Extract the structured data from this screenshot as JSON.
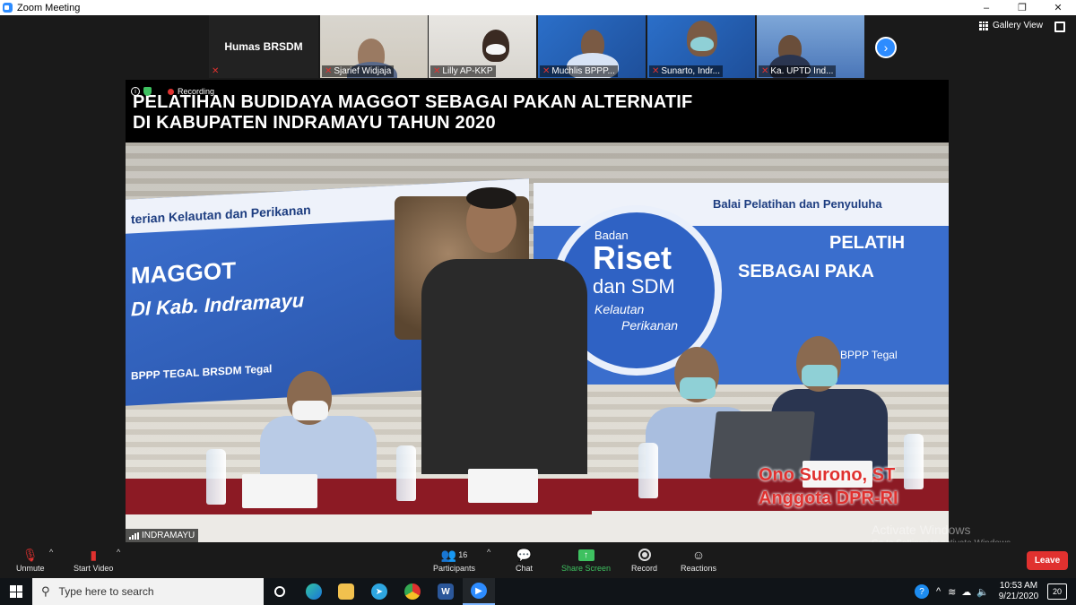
{
  "window": {
    "title": "Zoom Meeting",
    "controls": {
      "minimize": "–",
      "restore": "❐",
      "close": "✕"
    }
  },
  "strip": {
    "self_name": "Humas BRSDM",
    "participants": [
      {
        "name": "Sjarief Widjaja",
        "muted": true
      },
      {
        "name": "Lilly AP-KKP",
        "muted": true
      },
      {
        "name": "Muchlis BPPP...",
        "muted": true
      },
      {
        "name": "Sunarto, Indr...",
        "muted": true
      },
      {
        "name": "Ka. UPTD Ind...",
        "muted": true
      }
    ],
    "next_icon": "›",
    "gallery_view_label": "Gallery View"
  },
  "main_video": {
    "recording_label": "Recording",
    "title_line1": "PELATIHAN BUDIDAYA MAGGOT SEBAGAI PAKAN ALTERNATIF",
    "title_line2": "DI KABUPATEN INDRAMAYU TAHUN 2020",
    "banner_left": {
      "line1": "terian Kelautan dan Perikanan",
      "line2": "MAGGOT",
      "line3": "DI Kab. Indramayu",
      "line4": "BPPP TEGAL   BRSDM  Tegal"
    },
    "banner_right": {
      "line1": "Balai Pelatihan dan Penyuluha",
      "line2": "PELATIH",
      "line3": "SEBAGAI PAKA",
      "line4": "BPPP Tegal"
    },
    "logo": {
      "line1": "Badan",
      "line2": "Riset",
      "line3": "dan SDM",
      "line4": "Kelautan",
      "line5": "Perikanan"
    },
    "caption_name": "Ono Surono, ST",
    "caption_role": "Anggota DPR-RI",
    "speaker_label": "INDRAMAYU"
  },
  "watermark": {
    "line1": "Activate Windows",
    "line2": "Go to Settings to activate Windows."
  },
  "toolbar": {
    "unmute": "Unmute",
    "start_video": "Start Video",
    "participants": "Participants",
    "participants_count": "16",
    "chat": "Chat",
    "share_screen": "Share Screen",
    "record": "Record",
    "reactions": "Reactions",
    "leave": "Leave",
    "accent_green": "#3ec160",
    "leave_red": "#e0312f"
  },
  "taskbar": {
    "search_placeholder": "Type here to search",
    "apps": [
      "task-view",
      "edge",
      "file-explorer",
      "telegram",
      "chrome",
      "word",
      "zoom"
    ],
    "time": "10:53 AM",
    "date": "9/21/2020",
    "notifications": "20"
  }
}
